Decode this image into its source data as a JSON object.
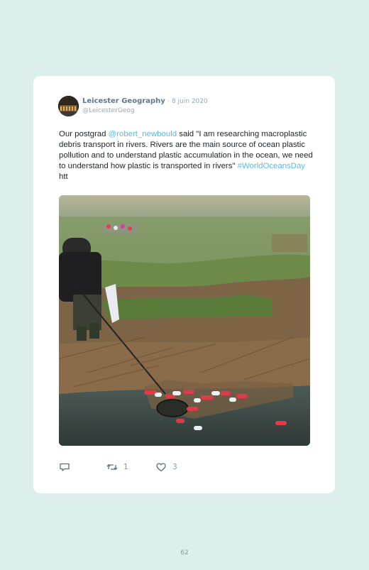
{
  "tweet": {
    "display_name": "Leicester Geography",
    "separator": "·",
    "date": "8 juin 2020",
    "handle": "@LeicesterGeog",
    "text_segments": [
      {
        "text": "Our postgrad ",
        "link": false
      },
      {
        "text": "@robert_newbould",
        "link": true
      },
      {
        "text": " said \"I am researching macroplastic debris transport in rivers. Rivers are the main source of ocean plastic pollution and to understand plastic accumulation in the ocean, we need to understand how plastic is transported in rivers\" ",
        "link": false
      },
      {
        "text": "#WorldOceansDay",
        "link": true
      },
      {
        "text": " htt",
        "link": false
      }
    ],
    "actions": {
      "reply": {
        "icon": "reply-icon",
        "count": ""
      },
      "retweet": {
        "icon": "retweet-icon",
        "count": "1"
      },
      "like": {
        "icon": "heart-icon",
        "count": "3"
      }
    }
  },
  "page": {
    "number": "62"
  },
  "colors": {
    "background": "#dcefec",
    "card": "#ffffff",
    "link": "#5fb7e6",
    "muted": "#9aa6b1"
  }
}
